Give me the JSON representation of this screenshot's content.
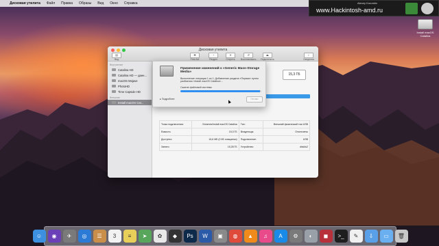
{
  "menubar": {
    "items": [
      "Дисковая утилита",
      "Файл",
      "Правка",
      "Образы",
      "Вид",
      "Окно",
      "Справка"
    ]
  },
  "watermark": {
    "site": "www.Hackintosh-amd.ru",
    "small_text": "Alexey Koronkin"
  },
  "desktop_icon": {
    "label": "Install macOS Catalina"
  },
  "window": {
    "title": "Дисковая утилита",
    "toolbar": [
      "Вид",
      "First Aid",
      "Раздел",
      "Стереть",
      "Восстановить",
      "Подключить",
      "Сведения"
    ],
    "sidebar": {
      "internal_header": "Внутренние",
      "internal_items": [
        "Catalina HD",
        "Catalina HD — данн...",
        "macOS Mojave",
        "PhotoHD",
        "Time Capsule HD"
      ],
      "external_header": "Внешние",
      "external_items": [
        "Install macOS Cat..."
      ]
    },
    "capacity": "15,3 ГБ",
    "usage": {
      "left": "15,3 ГБ",
      "right": "16,6 МБ"
    },
    "info_rows": [
      [
        "Точка подключения:",
        "/Volumes/Install macOS Catalina",
        "Тип:",
        "Внешний физический том USB"
      ],
      [
        "Емкость:",
        "15,3 ГБ",
        "Владельцы:",
        "Отключены"
      ],
      [
        "Доступно:",
        "16,6 МБ (0 КБ очищаемо)",
        "Подключение:",
        "USB"
      ],
      [
        "Занято:",
        "15,28 ГБ",
        "Устройство:",
        "disk4s2"
      ]
    ]
  },
  "sheet": {
    "title": "Применение изменений к «Generic Mass-Storage Media»",
    "description": "Выполнение операции 1 из 1: Добавление раздела «Первая» путем разбиения «Install macOS Catalina»...",
    "status": "Сжатие файловой системы",
    "progress": 0.98,
    "details_label": "Подробнее",
    "done_label": "Готово"
  },
  "dock": {
    "apps": [
      {
        "name": "finder",
        "glyph": "☺",
        "color": "#3d8fe0"
      },
      {
        "name": "siri",
        "glyph": "◉",
        "color": "#6a3fb8"
      },
      {
        "name": "launchpad",
        "glyph": "✈",
        "color": "#7a7a7a"
      },
      {
        "name": "safari",
        "glyph": "◎",
        "color": "#2a7ad6"
      },
      {
        "name": "contacts",
        "glyph": "☰",
        "color": "#c98f4a"
      },
      {
        "name": "calendar",
        "glyph": "3",
        "color": "#f2f2f2"
      },
      {
        "name": "notes",
        "glyph": "≡",
        "color": "#e8cf5a"
      },
      {
        "name": "maps",
        "glyph": "➤",
        "color": "#58a55c"
      },
      {
        "name": "photos",
        "glyph": "✿",
        "color": "#e8e8e8"
      },
      {
        "name": "final-cut",
        "glyph": "◆",
        "color": "#333333"
      },
      {
        "name": "photoshop",
        "glyph": "Ps",
        "color": "#0d2a4a"
      },
      {
        "name": "word",
        "glyph": "W",
        "color": "#2b5aa8"
      },
      {
        "name": "preview",
        "glyph": "▣",
        "color": "#8a8a8a"
      },
      {
        "name": "chrome",
        "glyph": "◍",
        "color": "#e04a3a"
      },
      {
        "name": "vlc",
        "glyph": "▲",
        "color": "#f08a1a"
      },
      {
        "name": "itunes",
        "glyph": "♫",
        "color": "#e84a8a"
      },
      {
        "name": "app-store",
        "glyph": "A",
        "color": "#1a8ae8"
      },
      {
        "name": "system-preferences",
        "glyph": "⚙",
        "color": "#7a7a7a"
      },
      {
        "name": "disk-utility",
        "glyph": "◐",
        "color": "#9aa0a8"
      },
      {
        "name": "photo-booth",
        "glyph": "◼",
        "color": "#b8303a"
      },
      {
        "name": "terminal",
        "glyph": ">_",
        "color": "#1e1e1e"
      },
      {
        "name": "text-edit",
        "glyph": "✎",
        "color": "#f0f0f0"
      },
      {
        "name": "downloads",
        "glyph": "⇩",
        "color": "#5aa0e8"
      },
      {
        "name": "folder",
        "glyph": "▭",
        "color": "#6ab0f0"
      },
      {
        "name": "trash",
        "glyph": "🗑",
        "color": "#c8c8c8"
      }
    ]
  }
}
